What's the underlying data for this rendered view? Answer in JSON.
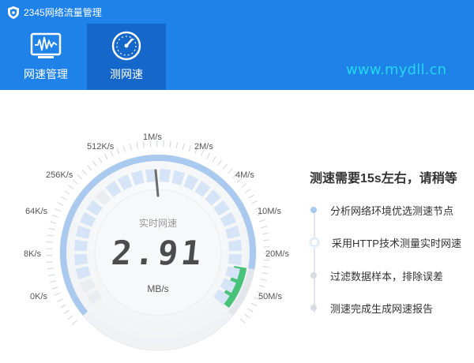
{
  "app": {
    "title": "2345网络流量管理"
  },
  "nav": [
    {
      "label": "网速管理",
      "icon": "monitor-graph-icon",
      "active": false
    },
    {
      "label": "测网速",
      "icon": "speedometer-icon",
      "active": true
    }
  ],
  "watermark": "www.mydll.cn",
  "gauge": {
    "scale_labels": [
      "0K/s",
      "8K/s",
      "64K/s",
      "256K/s",
      "512K/s",
      "1M/s",
      "2M/s",
      "4M/s",
      "10M/s",
      "20M/s",
      "50M/s"
    ],
    "caption": "实时网速",
    "value": "2.91",
    "unit": "MB/s"
  },
  "status": {
    "headline": "测速需要15s左右，请稍等",
    "steps": [
      {
        "label": "分析网络环境优选测速节点",
        "state": "done"
      },
      {
        "label": "采用HTTP技术测量实时网速",
        "state": "active"
      },
      {
        "label": "过滤数据样本，排除误差",
        "state": "pending"
      },
      {
        "label": "测速完成生成网速报告",
        "state": "pending"
      }
    ]
  },
  "colors": {
    "header_bg": "#1f82e8",
    "active_tab_bg": "#1568c9",
    "watermark": "#23d7ee",
    "gauge_progress": "#a9c9ef",
    "gauge_green": "#49c27a"
  }
}
